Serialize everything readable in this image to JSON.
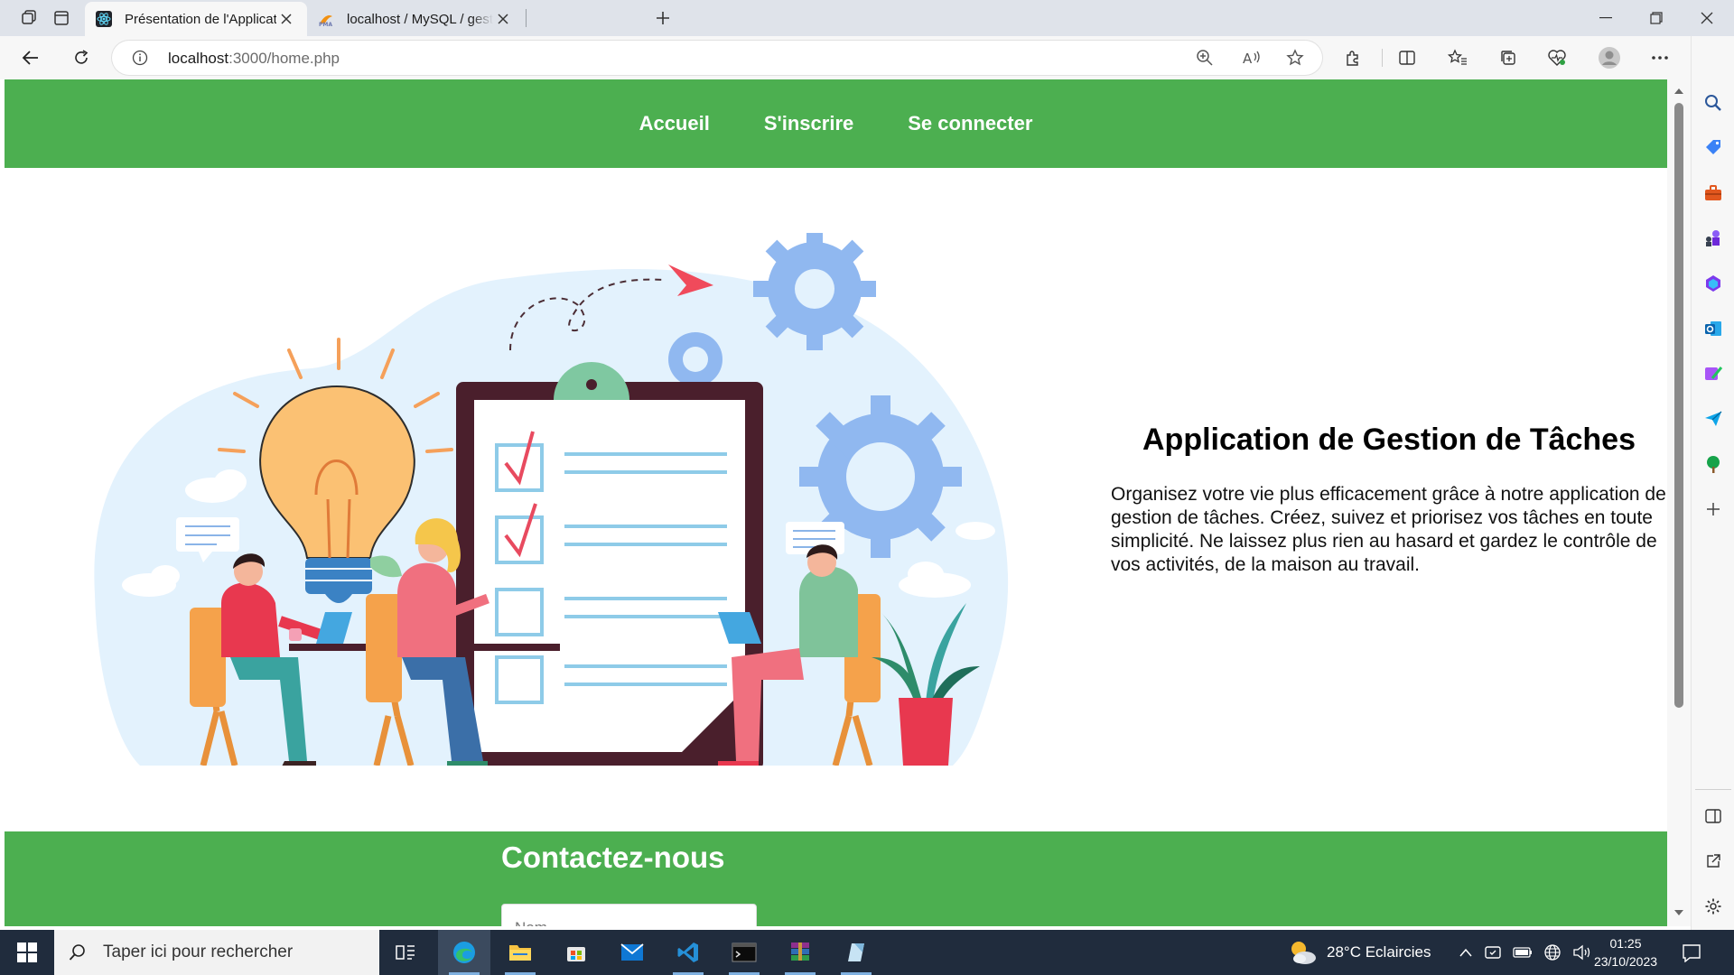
{
  "browser": {
    "tabs": [
      {
        "title": "Présentation de l'Application",
        "active": true
      },
      {
        "title": "localhost / MySQL / gestionentre",
        "active": false
      }
    ],
    "address": {
      "host": "localhost",
      "path": ":3000/home.php"
    }
  },
  "site": {
    "nav": {
      "items": [
        "Accueil",
        "S'inscrire",
        "Se connecter"
      ]
    },
    "intro": {
      "title": "Application de Gestion de Tâches",
      "text": "Organisez votre vie plus efficacement grâce à notre application de gestion de tâches. Créez, suivez et priorisez vos tâches en toute simplicité. Ne laissez plus rien au hasard et gardez le contrôle de vos activités, de la maison au travail."
    },
    "contact": {
      "title": "Contactez-nous",
      "name_placeholder": "Nom"
    }
  },
  "taskbar": {
    "search_placeholder": "Taper ici pour rechercher",
    "weather": "28°C  Eclaircies",
    "time": "01:25",
    "date": "23/10/2023"
  },
  "colors": {
    "brand_green": "#4caf50",
    "taskbar": "#202c3d"
  }
}
